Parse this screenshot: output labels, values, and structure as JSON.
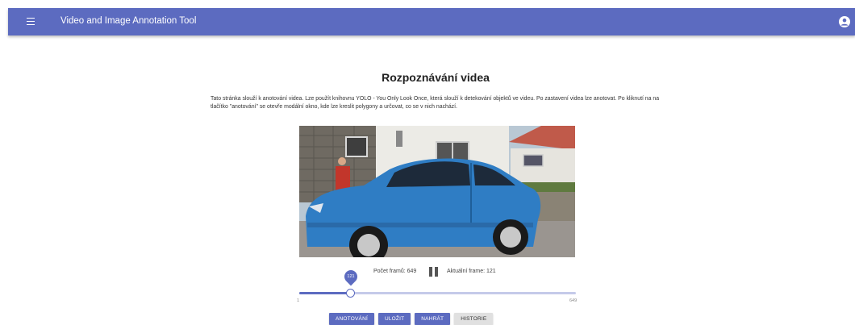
{
  "appbar": {
    "title": "Video and Image Annotation Tool",
    "menu_icon": "menu-icon",
    "account_icon": "account-circle-icon",
    "color": "#5c6bc0"
  },
  "page": {
    "title": "Rozpoznávání videa",
    "description": "Tato stránka slouží k anotování videa. Lze použít knihovnu YOLO - You Only Look Once, která slouží k detekování objektů ve videu. Po zastavení videa lze anotovat. Po kliknutí na na tlačítko \"anotování\" se otevře modální okno, kde lze kreslit polygony a určovat, co se v nich nachází."
  },
  "player": {
    "frame_count_text": "Počet framů: 649",
    "current_frame_text": "Aktuální frame: 121",
    "pause_icon": "pause-icon",
    "slider": {
      "min": 1,
      "max": 649,
      "value": 121,
      "min_label": "1",
      "max_label": "649",
      "value_label": "121"
    }
  },
  "actions": {
    "annotate": "ANOTOVÁNÍ",
    "save": "ULOŽIT",
    "upload": "NAHRÁT",
    "history": "HISTORIE"
  },
  "colors": {
    "primary": "#5c6bc0",
    "secondary_button": "#e0e0e0"
  }
}
